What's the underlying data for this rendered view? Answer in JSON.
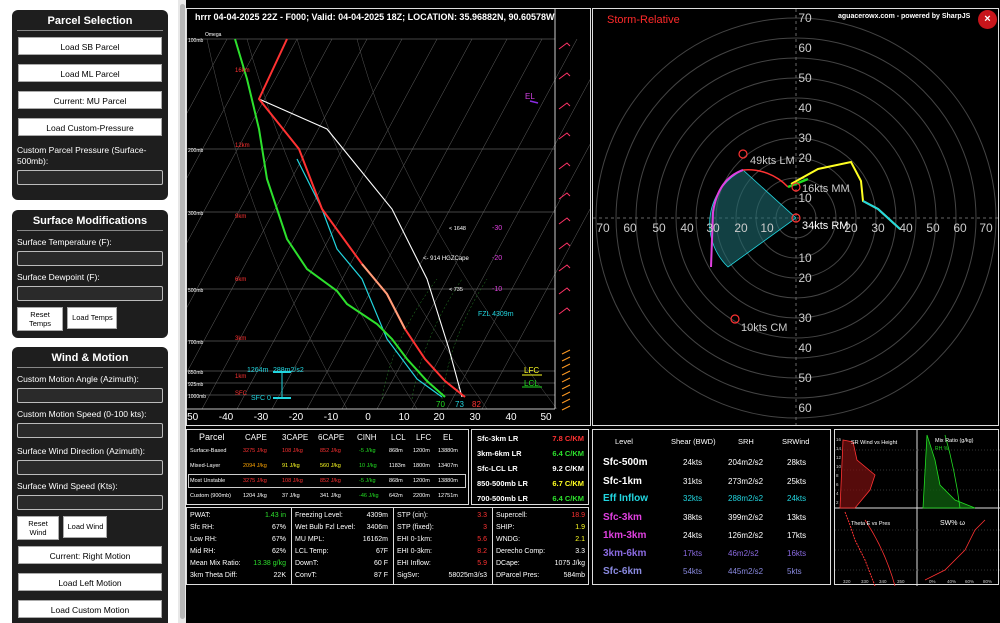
{
  "sidebar": {
    "parcel_selection": {
      "title": "Parcel Selection",
      "buttons": [
        "Load SB Parcel",
        "Load ML Parcel",
        "Current: MU Parcel",
        "Load Custom-Pressure"
      ],
      "custom_pressure_label": "Custom Parcel Pressure (Surface-500mb):"
    },
    "surface_mods": {
      "title": "Surface Modifications",
      "temp_label": "Surface Temperature (F):",
      "dewp_label": "Surface Dewpoint (F):",
      "reset_label": "Reset Temps",
      "load_label": "Load Temps"
    },
    "wind_motion": {
      "title": "Wind & Motion",
      "angle_label": "Custom Motion Angle (Azimuth):",
      "speed_label": "Custom Motion Speed (0-100 kts):",
      "sfc_dir_label": "Surface Wind Direction (Azimuth):",
      "sfc_spd_label": "Surface Wind Speed (Kts):",
      "reset_wind": "Reset Wind",
      "load_wind": "Load Wind",
      "buttons": [
        "Current: Right Motion",
        "Load Left Motion",
        "Load Custom Motion"
      ]
    }
  },
  "skewt": {
    "header": "hrrr 04-04-2025 22Z - F000;  Valid: 04-04-2025 18Z;  LOCATION: 35.96882N, 90.60578W",
    "omega": "Omega",
    "pressure_labels": [
      "100mb",
      "200mb",
      "300mb",
      "500mb",
      "700mb",
      "850mb",
      "925mb",
      "1000mb"
    ],
    "height_labels": [
      "16km",
      "12km",
      "9km",
      "6km",
      "3km",
      "1km",
      "SFC"
    ],
    "x_ticks": [
      "-50",
      "-40",
      "-30",
      "-20",
      "-10",
      "0",
      "10",
      "20",
      "30",
      "40",
      "50"
    ],
    "annotations": {
      "el": "EL",
      "lfc": "LFC",
      "lcl": "LCL",
      "fzl": "FZL 4309m",
      "hgz": "<- 914 HGZCape",
      "a1648": "< 1648",
      "a735": "< 735",
      "m30": "-30",
      "m20": "-20",
      "m10": "-10",
      "eff_layer": "1264m",
      "eff_srh": "288m2/s2",
      "sfc0": "SFC 0",
      "t70": "70",
      "t73": "73",
      "t82": "82"
    }
  },
  "hodograph": {
    "credit": "aguacerowx.com - powered by SharpJS",
    "title": "Storm-Relative",
    "ring_labels": [
      "70",
      "60",
      "50",
      "40",
      "30",
      "20",
      "10"
    ],
    "x_labels_left": [
      "70",
      "60",
      "50",
      "40",
      "30",
      "20",
      "10"
    ],
    "x_labels_right": [
      "20",
      "30",
      "40",
      "50",
      "60",
      "70"
    ],
    "lm": "49kts LM",
    "mm": "16kts MM",
    "rm": "34kts RM",
    "cm": "10kts CM",
    "close": "×"
  },
  "parcel_table": {
    "headers": [
      "Parcel",
      "CAPE",
      "3CAPE",
      "6CAPE",
      "CINH",
      "LCL",
      "LFC",
      "EL"
    ],
    "rows": [
      [
        "Surface-Based",
        "3275 J/kg",
        "108 J/kg",
        "852 J/kg",
        "-5 J/kg",
        "868m",
        "1200m",
        "13880m"
      ],
      [
        "Mixed-Layer",
        "2094 J/kg",
        "91 J/kg",
        "560 J/kg",
        "10 J/kg",
        "1183m",
        "1800m",
        "13407m"
      ],
      [
        "Most Unstable",
        "3275 J/kg",
        "108 J/kg",
        "852 J/kg",
        "-5 J/kg",
        "868m",
        "1200m",
        "13880m"
      ],
      [
        "Custom (900mb)",
        "1204 J/kg",
        "37 J/kg",
        "341 J/kg",
        "-46 J/kg",
        "642m",
        "2200m",
        "12751m"
      ]
    ]
  },
  "lapse_rates": [
    [
      "Sfc-3km LR",
      "7.8 C/KM"
    ],
    [
      "3km-6km LR",
      "6.4 C/KM"
    ],
    [
      "Sfc-LCL LR",
      "9.2 C/KM"
    ],
    [
      "850-500mb LR",
      "6.7 C/KM"
    ],
    [
      "700-500mb LR",
      "6.4 C/KM"
    ]
  ],
  "indices": {
    "col1": [
      [
        "PWAT:",
        "1.43 in"
      ],
      [
        "Sfc RH:",
        "67%"
      ],
      [
        "Low RH:",
        "67%"
      ],
      [
        "Mid RH:",
        "62%"
      ],
      [
        "Mean Mix Ratio:",
        "13.38 g/kg"
      ],
      [
        "3km Theta Diff:",
        "22K"
      ]
    ],
    "col2": [
      [
        "Freezing Level:",
        "4309m"
      ],
      [
        "Wet Bulb Fzl Level:",
        "3406m"
      ],
      [
        "MU MPL:",
        "16162m"
      ],
      [
        "LCL Temp:",
        "67F"
      ],
      [
        "DownT:",
        "60 F"
      ],
      [
        "ConvT:",
        "87 F"
      ]
    ],
    "col3": [
      [
        "STP (cin):",
        "3.3"
      ],
      [
        "STP (fixed):",
        "3"
      ],
      [
        "EHI 0-1km:",
        "5.6"
      ],
      [
        "EHI 0-3km:",
        "8.2"
      ],
      [
        "EHI Inflow:",
        "5.9"
      ],
      [
        "SigSvr:",
        "58025m3/s3"
      ]
    ],
    "col4": [
      [
        "Supercell:",
        "18.9"
      ],
      [
        "SHIP:",
        "1.9"
      ],
      [
        "WNDG:",
        "2.1"
      ],
      [
        "Derecho Comp:",
        "3.3"
      ],
      [
        "DCape:",
        "1075 J/kg"
      ],
      [
        "DParcel Pres:",
        "584mb"
      ]
    ]
  },
  "shear_table": {
    "headers": [
      "Level",
      "Shear (BWD)",
      "SRH",
      "SRWind"
    ],
    "rows": [
      [
        "Sfc-500m",
        "24kts",
        "204m2/s2",
        "28kts"
      ],
      [
        "Sfc-1km",
        "31kts",
        "273m2/s2",
        "25kts"
      ],
      [
        "Eff Inflow",
        "32kts",
        "288m2/s2",
        "24kts"
      ],
      [
        "Sfc-3km",
        "38kts",
        "399m2/s2",
        "13kts"
      ],
      [
        "1km-3km",
        "24kts",
        "126m2/s2",
        "17kts"
      ],
      [
        "3km-6km",
        "17kts",
        "46m2/s2",
        "16kts"
      ],
      [
        "Sfc-6km",
        "54kts",
        "445m2/s2",
        "5kts"
      ]
    ]
  },
  "mini_plots": {
    "p1": "SR Wind vs Height",
    "p2": "Mix Ratio (g/kg)",
    "p2sub": "RH %",
    "p3": "Theta E vs Pres",
    "p4": "SW% ω",
    "p1_ticks": [
      "16",
      "14",
      "12",
      "10",
      "8",
      "6",
      "4",
      "2"
    ],
    "p3_x": [
      "320",
      "330",
      "340",
      "350"
    ],
    "p4_x": [
      "0%",
      "40%",
      "60%",
      "80%"
    ]
  },
  "colors": {
    "accent": "#ff2a2a",
    "magenta": "#e040e0",
    "green": "#22dd22",
    "cyan": "#22d6e0",
    "yellow": "#ffff22"
  }
}
